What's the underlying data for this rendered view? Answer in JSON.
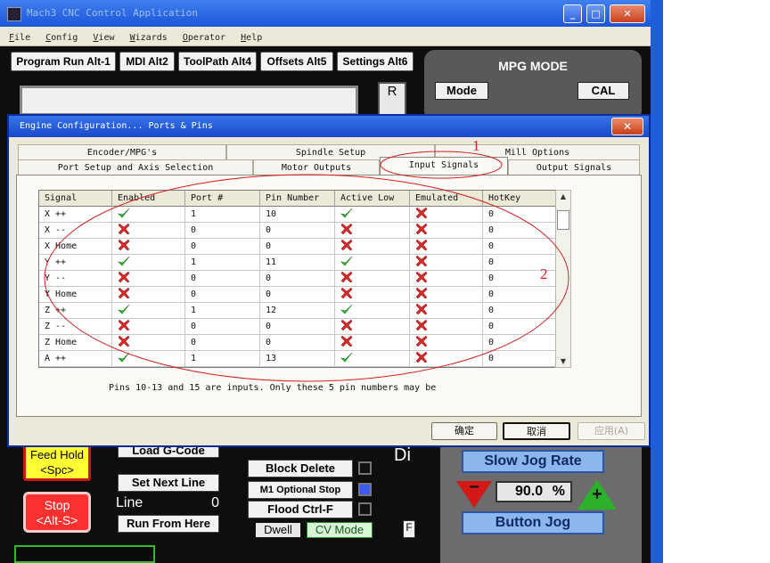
{
  "mach": {
    "title": "Mach3 CNC Control Application",
    "menu": [
      "File",
      "Config",
      "View",
      "Wizards",
      "Operator",
      "Help"
    ],
    "nav": [
      "Program Run Alt-1",
      "MDI Alt2",
      "ToolPath Alt4",
      "Offsets Alt5",
      "Settings Alt6"
    ],
    "mpg": {
      "title": "MPG MODE",
      "mode": "Mode",
      "cal": "CAL"
    },
    "ref": "R",
    "feed_hold": [
      "Feed Hold",
      "<Spc>"
    ],
    "stop": [
      "Stop",
      "<Alt-S>"
    ],
    "load_gcode": "Load G-Code",
    "set_next_line": "Set Next Line",
    "line_label": "Line",
    "line_value": "0",
    "run_from_here": "Run From Here",
    "block_delete": "Block Delete",
    "m1_optional_stop": "M1 Optional Stop",
    "flood": "Flood Ctrl-F",
    "dwell": "Dwell",
    "cv_mode": "CV Mode",
    "slow_jog_rate": "Slow Jog Rate",
    "jog_percent": "90.0",
    "jog_percent_unit": "%",
    "button_jog": "Button Jog",
    "side_text": "Di",
    "f_box": "F"
  },
  "dialog": {
    "title": "Engine Configuration... Ports & Pins",
    "tabs_back": [
      "Encoder/MPG's",
      "Spindle Setup",
      "Mill Options"
    ],
    "tabs_front": [
      "Port Setup and Axis Selection",
      "Motor Outputs",
      "Input Signals",
      "Output Signals"
    ],
    "active_tab": "Input Signals",
    "columns": [
      "Signal",
      "Enabled",
      "Port #",
      "Pin Number",
      "Active Low",
      "Emulated",
      "HotKey"
    ],
    "rows": [
      {
        "signal": "X ++",
        "enabled": true,
        "port": "1",
        "pin": "10",
        "active_low": true,
        "emulated": false,
        "hotkey": "0"
      },
      {
        "signal": "X --",
        "enabled": false,
        "port": "0",
        "pin": "0",
        "active_low": false,
        "emulated": false,
        "hotkey": "0"
      },
      {
        "signal": "X Home",
        "enabled": false,
        "port": "0",
        "pin": "0",
        "active_low": false,
        "emulated": false,
        "hotkey": "0"
      },
      {
        "signal": "Y ++",
        "enabled": true,
        "port": "1",
        "pin": "11",
        "active_low": true,
        "emulated": false,
        "hotkey": "0"
      },
      {
        "signal": "Y --",
        "enabled": false,
        "port": "0",
        "pin": "0",
        "active_low": false,
        "emulated": false,
        "hotkey": "0"
      },
      {
        "signal": "Y Home",
        "enabled": false,
        "port": "0",
        "pin": "0",
        "active_low": false,
        "emulated": false,
        "hotkey": "0"
      },
      {
        "signal": "Z ++",
        "enabled": true,
        "port": "1",
        "pin": "12",
        "active_low": true,
        "emulated": false,
        "hotkey": "0"
      },
      {
        "signal": "Z --",
        "enabled": false,
        "port": "0",
        "pin": "0",
        "active_low": false,
        "emulated": false,
        "hotkey": "0"
      },
      {
        "signal": "Z Home",
        "enabled": false,
        "port": "0",
        "pin": "0",
        "active_low": false,
        "emulated": false,
        "hotkey": "0"
      },
      {
        "signal": "A ++",
        "enabled": true,
        "port": "1",
        "pin": "13",
        "active_low": true,
        "emulated": false,
        "hotkey": "0"
      }
    ],
    "note": "Pins 10-13 and 15 are inputs. Only these 5 pin numbers may be",
    "buttons": {
      "ok": "确定",
      "cancel": "取消",
      "apply": "应用(A)"
    }
  },
  "annotations": {
    "label_1": "1",
    "label_2": "2",
    "color": "#d42020"
  },
  "colors": {
    "check": "#2db82d",
    "cross": "#d42a2a",
    "title_blue": "#1b56d8"
  }
}
